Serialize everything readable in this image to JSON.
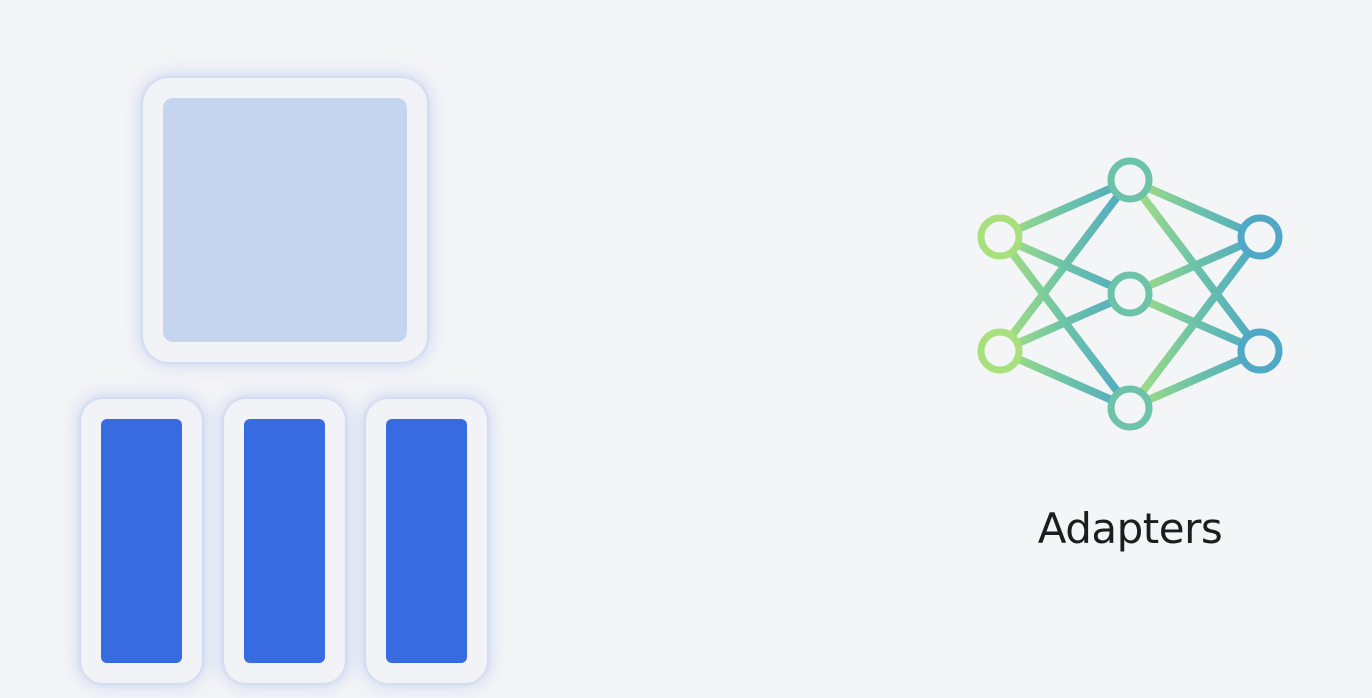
{
  "colors": {
    "background": "#f4f5f7",
    "tile_frame": "#f2f3f7",
    "base_model_fill": "#c5d5ef",
    "adapter_block_fill": "#386be0",
    "network_gradient_start": "#a8e07e",
    "network_gradient_mid": "#6cc3a8",
    "network_gradient_end": "#4fa8c6",
    "label_text": "#1d1d1f"
  },
  "diagram": {
    "base_model_block": {
      "icon": "rounded-square"
    },
    "adapter_blocks": [
      {
        "icon": "rounded-rectangle"
      },
      {
        "icon": "rounded-rectangle"
      },
      {
        "icon": "rounded-rectangle"
      }
    ],
    "neural_network_icon": {
      "icon": "neural-network-icon",
      "layers": [
        2,
        3,
        2
      ]
    },
    "label": "Adapters"
  }
}
